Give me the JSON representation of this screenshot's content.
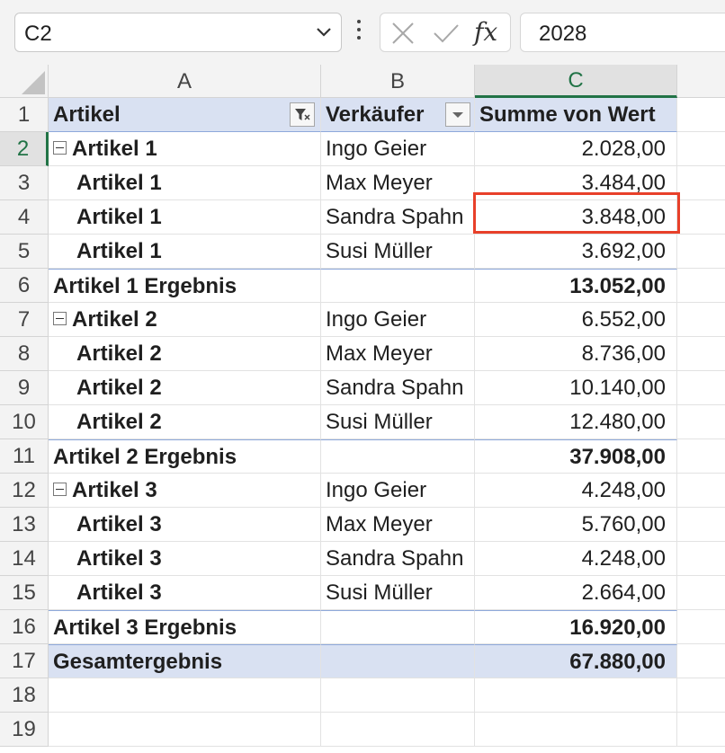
{
  "formula_bar": {
    "name_box": "C2",
    "formula_value": "2028",
    "fx_label": "fx",
    "icons": [
      "chevron-down-icon",
      "more-vertical-icon",
      "cancel-icon",
      "confirm-icon",
      "function-icon"
    ]
  },
  "columns": [
    "A",
    "B",
    "C"
  ],
  "header_row": {
    "num": "1",
    "a": "Artikel",
    "b": "Verkäufer",
    "c": "Summe von Wert"
  },
  "rows": [
    {
      "num": "2",
      "a": "Artikel 1",
      "b": "Ingo Geier",
      "c": "2.028,00"
    },
    {
      "num": "3",
      "a": "Artikel 1",
      "b": "Max Meyer",
      "c": "3.484,00"
    },
    {
      "num": "4",
      "a": "Artikel 1",
      "b": "Sandra Spahn",
      "c": "3.848,00"
    },
    {
      "num": "5",
      "a": "Artikel 1",
      "b": "Susi Müller",
      "c": "3.692,00"
    },
    {
      "num": "6",
      "a": "Artikel 1 Ergebnis",
      "b": "",
      "c": "13.052,00"
    },
    {
      "num": "7",
      "a": "Artikel 2",
      "b": "Ingo Geier",
      "c": "6.552,00"
    },
    {
      "num": "8",
      "a": "Artikel 2",
      "b": "Max Meyer",
      "c": "8.736,00"
    },
    {
      "num": "9",
      "a": "Artikel 2",
      "b": "Sandra Spahn",
      "c": "10.140,00"
    },
    {
      "num": "10",
      "a": "Artikel 2",
      "b": "Susi Müller",
      "c": "12.480,00"
    },
    {
      "num": "11",
      "a": "Artikel 2 Ergebnis",
      "b": "",
      "c": "37.908,00"
    },
    {
      "num": "12",
      "a": "Artikel 3",
      "b": "Ingo Geier",
      "c": "4.248,00"
    },
    {
      "num": "13",
      "a": "Artikel 3",
      "b": "Max Meyer",
      "c": "5.760,00"
    },
    {
      "num": "14",
      "a": "Artikel 3",
      "b": "Sandra Spahn",
      "c": "4.248,00"
    },
    {
      "num": "15",
      "a": "Artikel 3",
      "b": "Susi Müller",
      "c": "2.664,00"
    },
    {
      "num": "16",
      "a": "Artikel 3 Ergebnis",
      "b": "",
      "c": "16.920,00"
    },
    {
      "num": "17",
      "a": "Gesamtergebnis",
      "b": "",
      "c": "67.880,00"
    },
    {
      "num": "18",
      "a": "",
      "b": "",
      "c": ""
    },
    {
      "num": "19",
      "a": "",
      "b": "",
      "c": ""
    }
  ],
  "colors": {
    "accent": "#217346",
    "pivot_header_fill": "#d9e1f2",
    "highlight_border": "#e8402a"
  }
}
